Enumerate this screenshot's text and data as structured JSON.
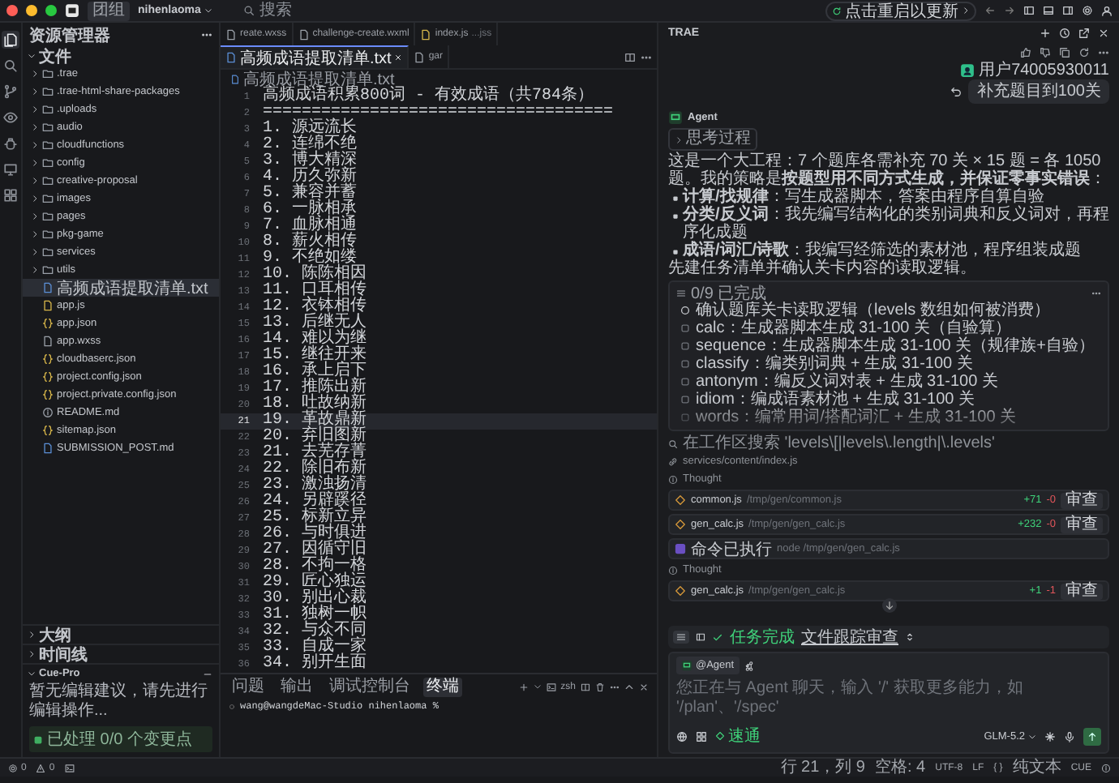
{
  "title_bar": {
    "workspace_badge": "团组",
    "project": "nihenlaoma",
    "search": {
      "placeholder": "搜索"
    },
    "update_pill": "点击重启以更新"
  },
  "activity_bar": [
    {
      "kind": "files",
      "selected": true
    },
    {
      "kind": "search",
      "selected": false
    },
    {
      "kind": "branch",
      "selected": false
    },
    {
      "kind": "eye",
      "selected": false
    },
    {
      "kind": "bug",
      "selected": false
    },
    {
      "kind": "monitor",
      "selected": false
    },
    {
      "kind": "grid",
      "selected": false
    }
  ],
  "sidebar": {
    "title": "资源管理器",
    "root": {
      "label": "文件",
      "expanded": true,
      "children": [
        {
          "kind": "folder",
          "label": ".trae",
          "expanded": false,
          "selected": false
        },
        {
          "kind": "folder",
          "label": ".trae-html-share-packages",
          "expanded": false,
          "selected": false
        },
        {
          "kind": "folder",
          "label": ".uploads",
          "expanded": false,
          "selected": false
        },
        {
          "kind": "folder",
          "label": "audio",
          "expanded": false,
          "selected": false
        },
        {
          "kind": "folder",
          "label": "cloudfunctions",
          "expanded": false,
          "selected": false
        },
        {
          "kind": "folder",
          "label": "config",
          "expanded": false,
          "selected": false
        },
        {
          "kind": "folder",
          "label": "creative-proposal",
          "expanded": false,
          "selected": false
        },
        {
          "kind": "folder",
          "label": "images",
          "expanded": false,
          "selected": false
        },
        {
          "kind": "folder",
          "label": "pages",
          "expanded": false,
          "selected": false
        },
        {
          "kind": "folder",
          "label": "pkg-game",
          "expanded": false,
          "selected": false
        },
        {
          "kind": "folder",
          "label": "services",
          "expanded": false,
          "selected": false
        },
        {
          "kind": "folder",
          "label": "utils",
          "expanded": false,
          "selected": false
        },
        {
          "kind": "text",
          "label": "高频成语提取清单.txt",
          "selected": true
        },
        {
          "kind": "script",
          "label": "app.js",
          "selected": false
        },
        {
          "kind": "json",
          "label": "app.json",
          "selected": false
        },
        {
          "kind": "file",
          "label": "app.wxss",
          "selected": false
        },
        {
          "kind": "json",
          "label": "cloudbaserc.json",
          "selected": false
        },
        {
          "kind": "json",
          "label": "project.config.json",
          "selected": false
        },
        {
          "kind": "json",
          "label": "project.private.config.json",
          "selected": false
        },
        {
          "kind": "info",
          "label": "README.md",
          "selected": false
        },
        {
          "kind": "json",
          "label": "sitemap.json",
          "selected": false
        },
        {
          "kind": "text",
          "label": "SUBMISSION_POST.md",
          "selected": false
        }
      ]
    },
    "sections": [
      {
        "label": "大纲",
        "expanded": false
      },
      {
        "label": "时间线",
        "expanded": false
      },
      {
        "label": "Cue-Pro",
        "expanded": true
      }
    ],
    "cue_message": "暂无编辑建议，请先进行编辑操作...",
    "cue_status": "已处理 0/0 个变更点"
  },
  "editor": {
    "tabs": [
      {
        "kind": "file",
        "label": "reate.wxss",
        "selected": false
      },
      {
        "kind": "file",
        "label": "challenge-create.wxml",
        "selected": false
      },
      {
        "kind": "script",
        "label": "index.js",
        "detail": "...jss",
        "selected": false
      },
      {
        "kind": "text",
        "label": "高频成语提取清单.txt",
        "selected": true
      },
      {
        "kind": "file",
        "label": "gar",
        "selected": false
      }
    ],
    "breadcrumb": "高频成语提取清单.txt",
    "lines": [
      {
        "number": "1",
        "text": "高频成语积累800词 - 有效成语（共784条）",
        "selected": false
      },
      {
        "number": "2",
        "text": "====================================",
        "selected": false
      },
      {
        "number": "3",
        "text": "1. 源远流长",
        "selected": false
      },
      {
        "number": "4",
        "text": "2. 连绵不绝",
        "selected": false
      },
      {
        "number": "5",
        "text": "3. 博大精深",
        "selected": false
      },
      {
        "number": "6",
        "text": "4. 历久弥新",
        "selected": false
      },
      {
        "number": "7",
        "text": "5. 兼容并蓄",
        "selected": false
      },
      {
        "number": "8",
        "text": "6. 一脉相承",
        "selected": false
      },
      {
        "number": "9",
        "text": "7. 血脉相通",
        "selected": false
      },
      {
        "number": "10",
        "text": "8. 薪火相传",
        "selected": false
      },
      {
        "number": "11",
        "text": "9. 不绝如缕",
        "selected": false
      },
      {
        "number": "12",
        "text": "10. 陈陈相因",
        "selected": false
      },
      {
        "number": "13",
        "text": "11. 口耳相传",
        "selected": false
      },
      {
        "number": "14",
        "text": "12. 衣钵相传",
        "selected": false
      },
      {
        "number": "15",
        "text": "13. 后继无人",
        "selected": false
      },
      {
        "number": "16",
        "text": "14. 难以为继",
        "selected": false
      },
      {
        "number": "17",
        "text": "15. 继往开来",
        "selected": false
      },
      {
        "number": "18",
        "text": "16. 承上启下",
        "selected": false
      },
      {
        "number": "19",
        "text": "17. 推陈出新",
        "selected": false
      },
      {
        "number": "20",
        "text": "18. 吐故纳新",
        "selected": false
      },
      {
        "number": "21",
        "text": "19. 革故鼎新",
        "selected": true
      },
      {
        "number": "22",
        "text": "20. 弃旧图新",
        "selected": false
      },
      {
        "number": "23",
        "text": "21. 去芜存菁",
        "selected": false
      },
      {
        "number": "24",
        "text": "22. 除旧布新",
        "selected": false
      },
      {
        "number": "25",
        "text": "23. 激浊扬清",
        "selected": false
      },
      {
        "number": "26",
        "text": "24. 另辟蹊径",
        "selected": false
      },
      {
        "number": "27",
        "text": "25. 标新立异",
        "selected": false
      },
      {
        "number": "28",
        "text": "26. 与时俱进",
        "selected": false
      },
      {
        "number": "29",
        "text": "27. 因循守旧",
        "selected": false
      },
      {
        "number": "30",
        "text": "28. 不拘一格",
        "selected": false
      },
      {
        "number": "31",
        "text": "29. 匠心独运",
        "selected": false
      },
      {
        "number": "32",
        "text": "30. 别出心裁",
        "selected": false
      },
      {
        "number": "33",
        "text": "31. 独树一帜",
        "selected": false
      },
      {
        "number": "34",
        "text": "32. 与众不同",
        "selected": false
      },
      {
        "number": "35",
        "text": "33. 自成一家",
        "selected": false
      },
      {
        "number": "36",
        "text": "34. 别开生面",
        "selected": false
      }
    ]
  },
  "panel": {
    "tabs": [
      {
        "label": "问题",
        "selected": false
      },
      {
        "label": "输出",
        "selected": false
      },
      {
        "label": "调试控制台",
        "selected": false
      },
      {
        "label": "终端",
        "selected": true
      }
    ],
    "shell": "zsh",
    "prompt": "wang@wangdeMac-Studio nihenlaoma %"
  },
  "assistant": {
    "title": "TRAE",
    "user": {
      "name": "用户74005930011",
      "message": "补充题目到100关"
    },
    "agent_label": "Agent",
    "thinking_label": "思考过程",
    "intro": "这是一个大工程：7 个题库各需补充 70 关 × 15 题 = 各 1050 题。我的策略是**按题型用不同方式生成，并保证零事实错误**：",
    "bullets": [
      "**计算/找规律**：写生成器脚本，答案由程序自算自验",
      "**分类/反义词**：我先编写结构化的类别词典和反义词对，再程序化成题",
      "**成语/词汇/诗歌**：我编写经筛选的素材池，程序组装成题"
    ],
    "plan_note": "先建任务清单并确认关卡内容的读取逻辑。",
    "todo": {
      "progress": "0/9 已完成",
      "items": [
        {
          "kind": "active",
          "text": "确认题库关卡读取逻辑（levels 数组如何被消费）"
        },
        {
          "kind": "pending",
          "text": "calc：生成器脚本生成 31-100 关（自验算）"
        },
        {
          "kind": "pending",
          "text": "sequence：生成器脚本生成 31-100 关（规律族+自验）"
        },
        {
          "kind": "pending",
          "text": "classify：编类别词典 + 生成 31-100 关"
        },
        {
          "kind": "pending",
          "text": "antonym：编反义词对表 + 生成 31-100 关"
        },
        {
          "kind": "pending",
          "text": "idiom：编成语素材池 + 生成 31-100 关"
        },
        {
          "kind": "pending",
          "text": "words：编常用词/搭配词汇 + 生成 31-100 关"
        }
      ]
    },
    "steps": [
      {
        "kind": "search",
        "text": "在工作区搜索 'levels\\[|levels\\.length|\\.levels'"
      },
      {
        "kind": "file_ref",
        "text": "services/content/index.js"
      },
      {
        "kind": "thought",
        "text": "Thought"
      },
      {
        "kind": "edit",
        "name": "common.js",
        "path": "/tmp/gen/common.js",
        "added": "+71",
        "removed": "-0",
        "action": "审查"
      },
      {
        "kind": "edit",
        "name": "gen_calc.js",
        "path": "/tmp/gen/gen_calc.js",
        "added": "+232",
        "removed": "-0",
        "action": "审查"
      },
      {
        "kind": "command",
        "name": "命令已执行",
        "path": "node /tmp/gen/gen_calc.js"
      },
      {
        "kind": "thought",
        "text": "Thought"
      },
      {
        "kind": "edit",
        "name": "gen_calc.js",
        "path": "/tmp/gen/gen_calc.js",
        "added": "+1",
        "removed": "-1",
        "action": "审查"
      }
    ],
    "task_bar": {
      "status": "任务完成",
      "link": "文件跟踪审查"
    },
    "composer": {
      "mention": "@Agent",
      "placeholder": "您正在与 Agent 聊天，输入 '/' 获取更多能力，如 '/plan'、'/spec'",
      "mode": "速通",
      "model": "GLM-5.2"
    }
  },
  "status_bar": {
    "errors": "0",
    "warnings": "0",
    "items": [
      "行 21，列 9",
      "空格: 4",
      "UTF-8",
      "LF",
      "{ }",
      "纯文本",
      "CUE"
    ]
  }
}
